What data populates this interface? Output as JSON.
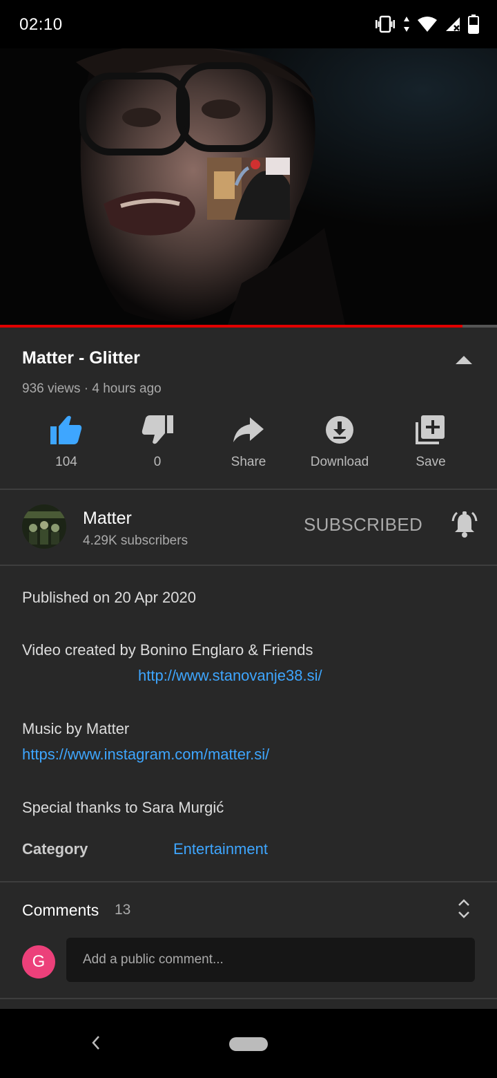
{
  "status_bar": {
    "time": "02:10",
    "icons": [
      "vibrate-icon",
      "data-transfer-icon",
      "wifi-icon",
      "signal-no-data-icon",
      "battery-icon"
    ]
  },
  "video": {
    "progress": 0.93,
    "colors": {
      "progress": "#e00000",
      "track": "#555555"
    }
  },
  "video_info": {
    "title": "Matter - Glitter",
    "meta": "936 views · 4 hours ago",
    "collapse_icon": "chevron-up-icon"
  },
  "actions": [
    {
      "icon": "thumbs-up-icon",
      "label": "104",
      "active": true
    },
    {
      "icon": "thumbs-down-icon",
      "label": "0"
    },
    {
      "icon": "share-icon",
      "label": "Share"
    },
    {
      "icon": "download-icon",
      "label": "Download"
    },
    {
      "icon": "save-playlist-icon",
      "label": "Save"
    }
  ],
  "channel": {
    "name": "Matter",
    "subscribers": "4.29K subscribers",
    "subscribe_label": "SUBSCRIBED",
    "bell_icon": "notification-bell-icon"
  },
  "description": {
    "published": "Published on 20 Apr 2020",
    "line1": "Video created by Bonino Englaro & Friends",
    "link1": "http://www.stanovanje38.si/",
    "line2": "Music by Matter",
    "link2": "https://www.instagram.com/matter.si/",
    "line3": "Special thanks to Sara Murgić",
    "category_label": "Category",
    "category_value": "Entertainment"
  },
  "comments": {
    "label": "Comments",
    "count": "13",
    "user_initial": "G",
    "placeholder": "Add a public comment...",
    "expand_icon": "expand-icon"
  },
  "nav_bar": {
    "back_icon": "back-icon",
    "home_icon": "home-pill-icon"
  },
  "colors": {
    "background": "#282828",
    "link": "#3ea6ff",
    "like_active": "#3ea6ff",
    "avatar": "#ec407a"
  }
}
